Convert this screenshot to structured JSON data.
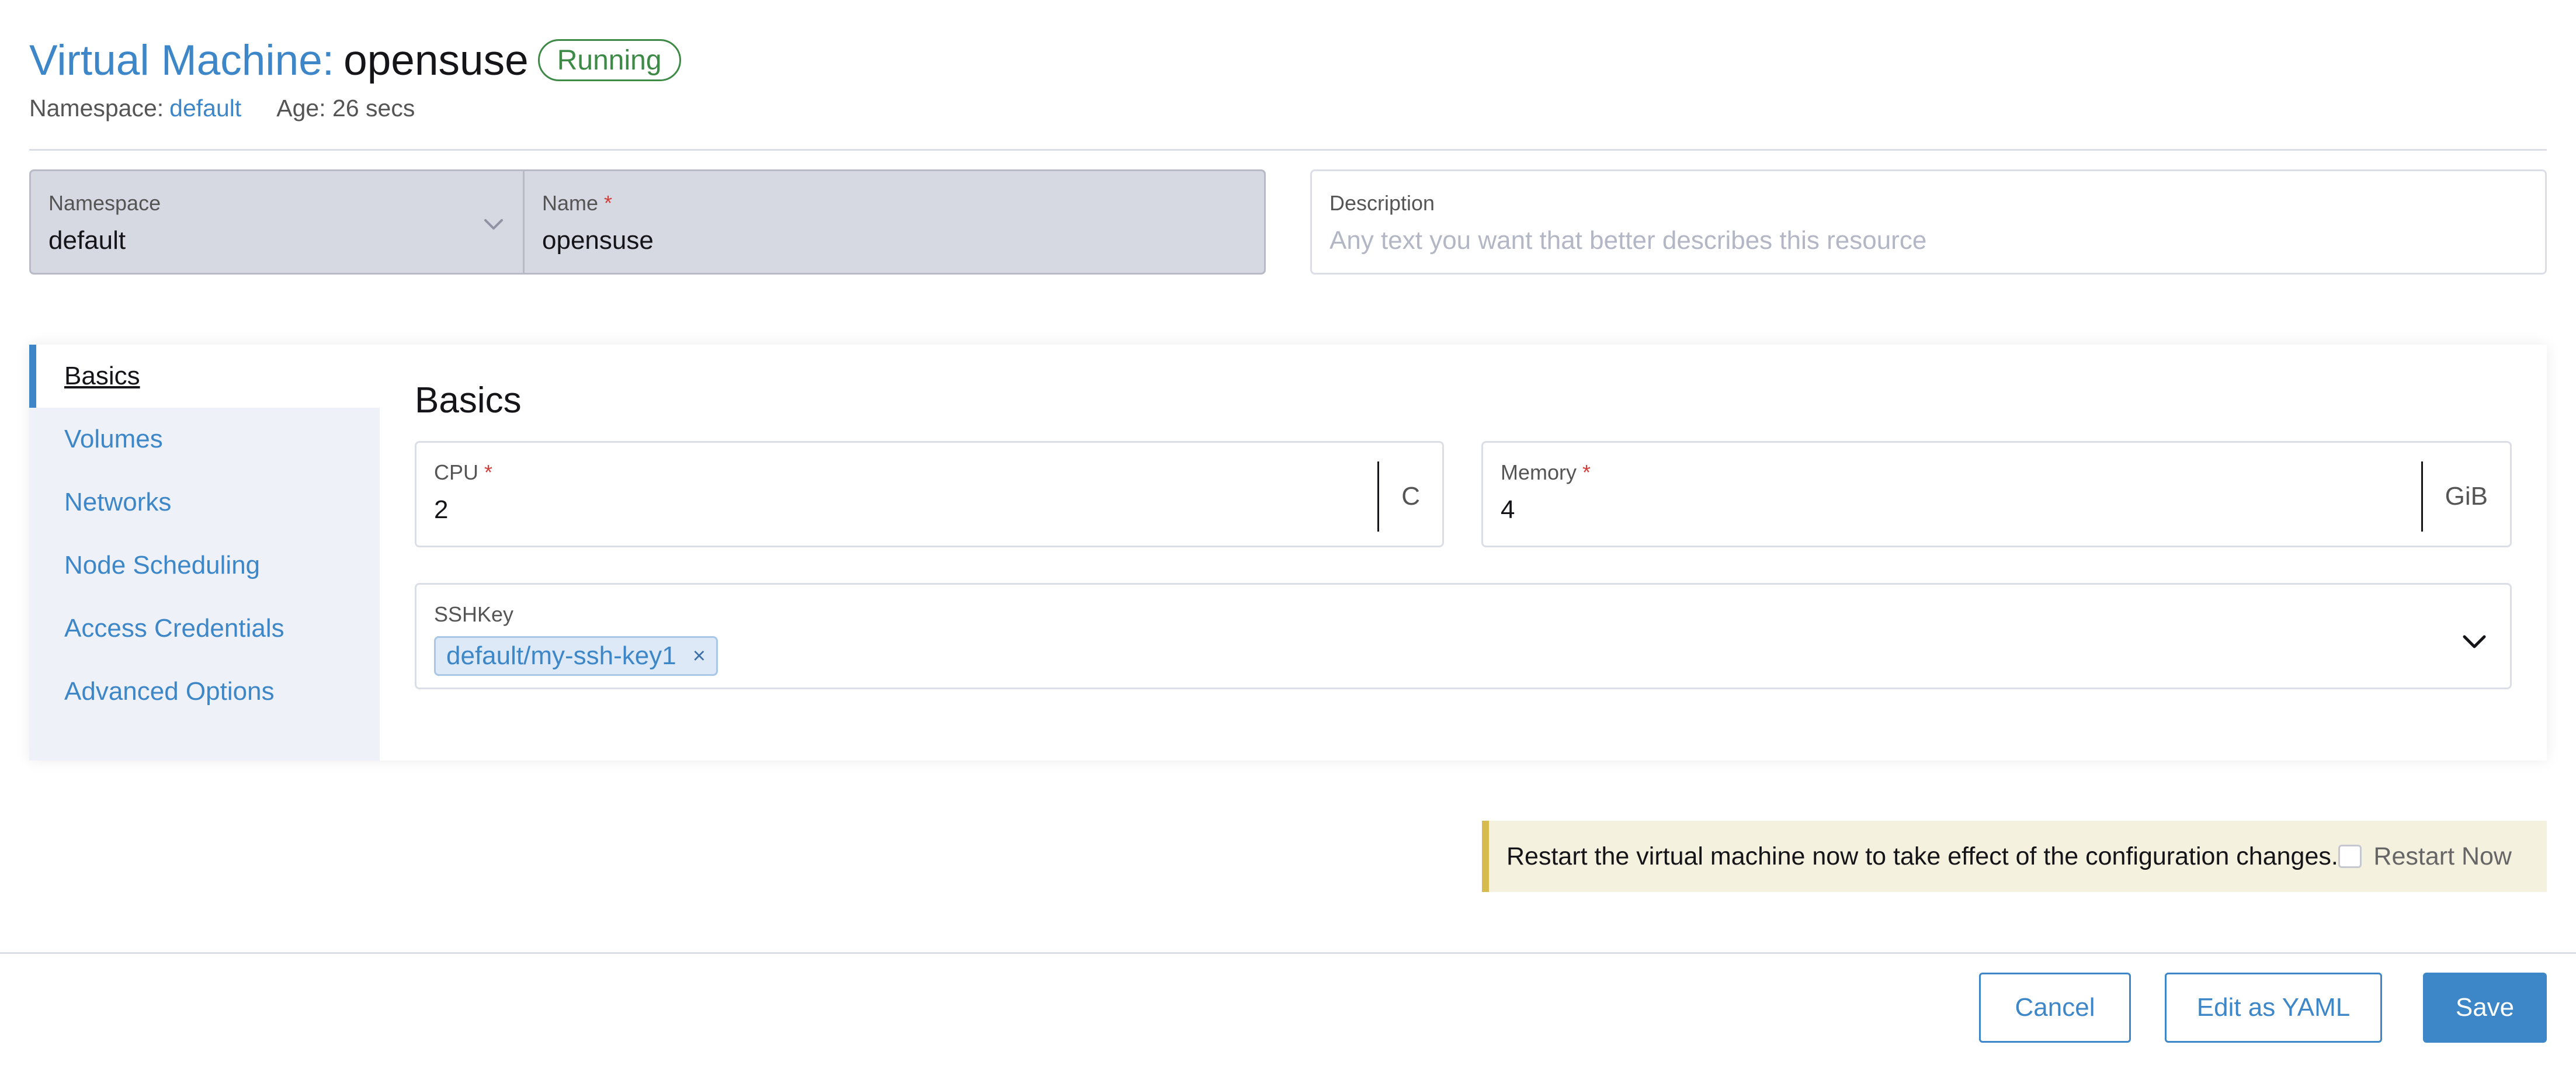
{
  "header": {
    "title_prefix": "Virtual Machine:",
    "title_name": "opensuse",
    "status": "Running",
    "namespace_label": "Namespace:",
    "namespace_value": "default",
    "age": "Age: 26 secs"
  },
  "fields": {
    "namespace_label": "Namespace",
    "namespace_value": "default",
    "name_label": "Name",
    "name_value": "opensuse",
    "required_marker": "*",
    "description_label": "Description",
    "description_placeholder": "Any text you want that better describes this resource"
  },
  "sidenav": {
    "items": [
      {
        "label": "Basics"
      },
      {
        "label": "Volumes"
      },
      {
        "label": "Networks"
      },
      {
        "label": "Node Scheduling"
      },
      {
        "label": "Access Credentials"
      },
      {
        "label": "Advanced Options"
      }
    ],
    "active": "Basics"
  },
  "basics": {
    "title": "Basics",
    "cpu_label": "CPU",
    "cpu_value": "2",
    "cpu_unit": "C",
    "memory_label": "Memory",
    "memory_value": "4",
    "memory_unit": "GiB",
    "sshkey_label": "SSHKey",
    "sshkey_chip": "default/my-ssh-key1",
    "chip_remove": "×"
  },
  "banner": {
    "text": "Restart the virtual machine now to take effect of the configuration changes.",
    "restart_label": "Restart Now"
  },
  "footer": {
    "cancel": "Cancel",
    "edit_yaml": "Edit as YAML",
    "save": "Save"
  },
  "colors": {
    "accent": "#3d87c8",
    "running": "#3d8a47",
    "required": "#d23f3a",
    "banner_bg": "#f5f1df",
    "banner_border": "#d8bb4e"
  }
}
